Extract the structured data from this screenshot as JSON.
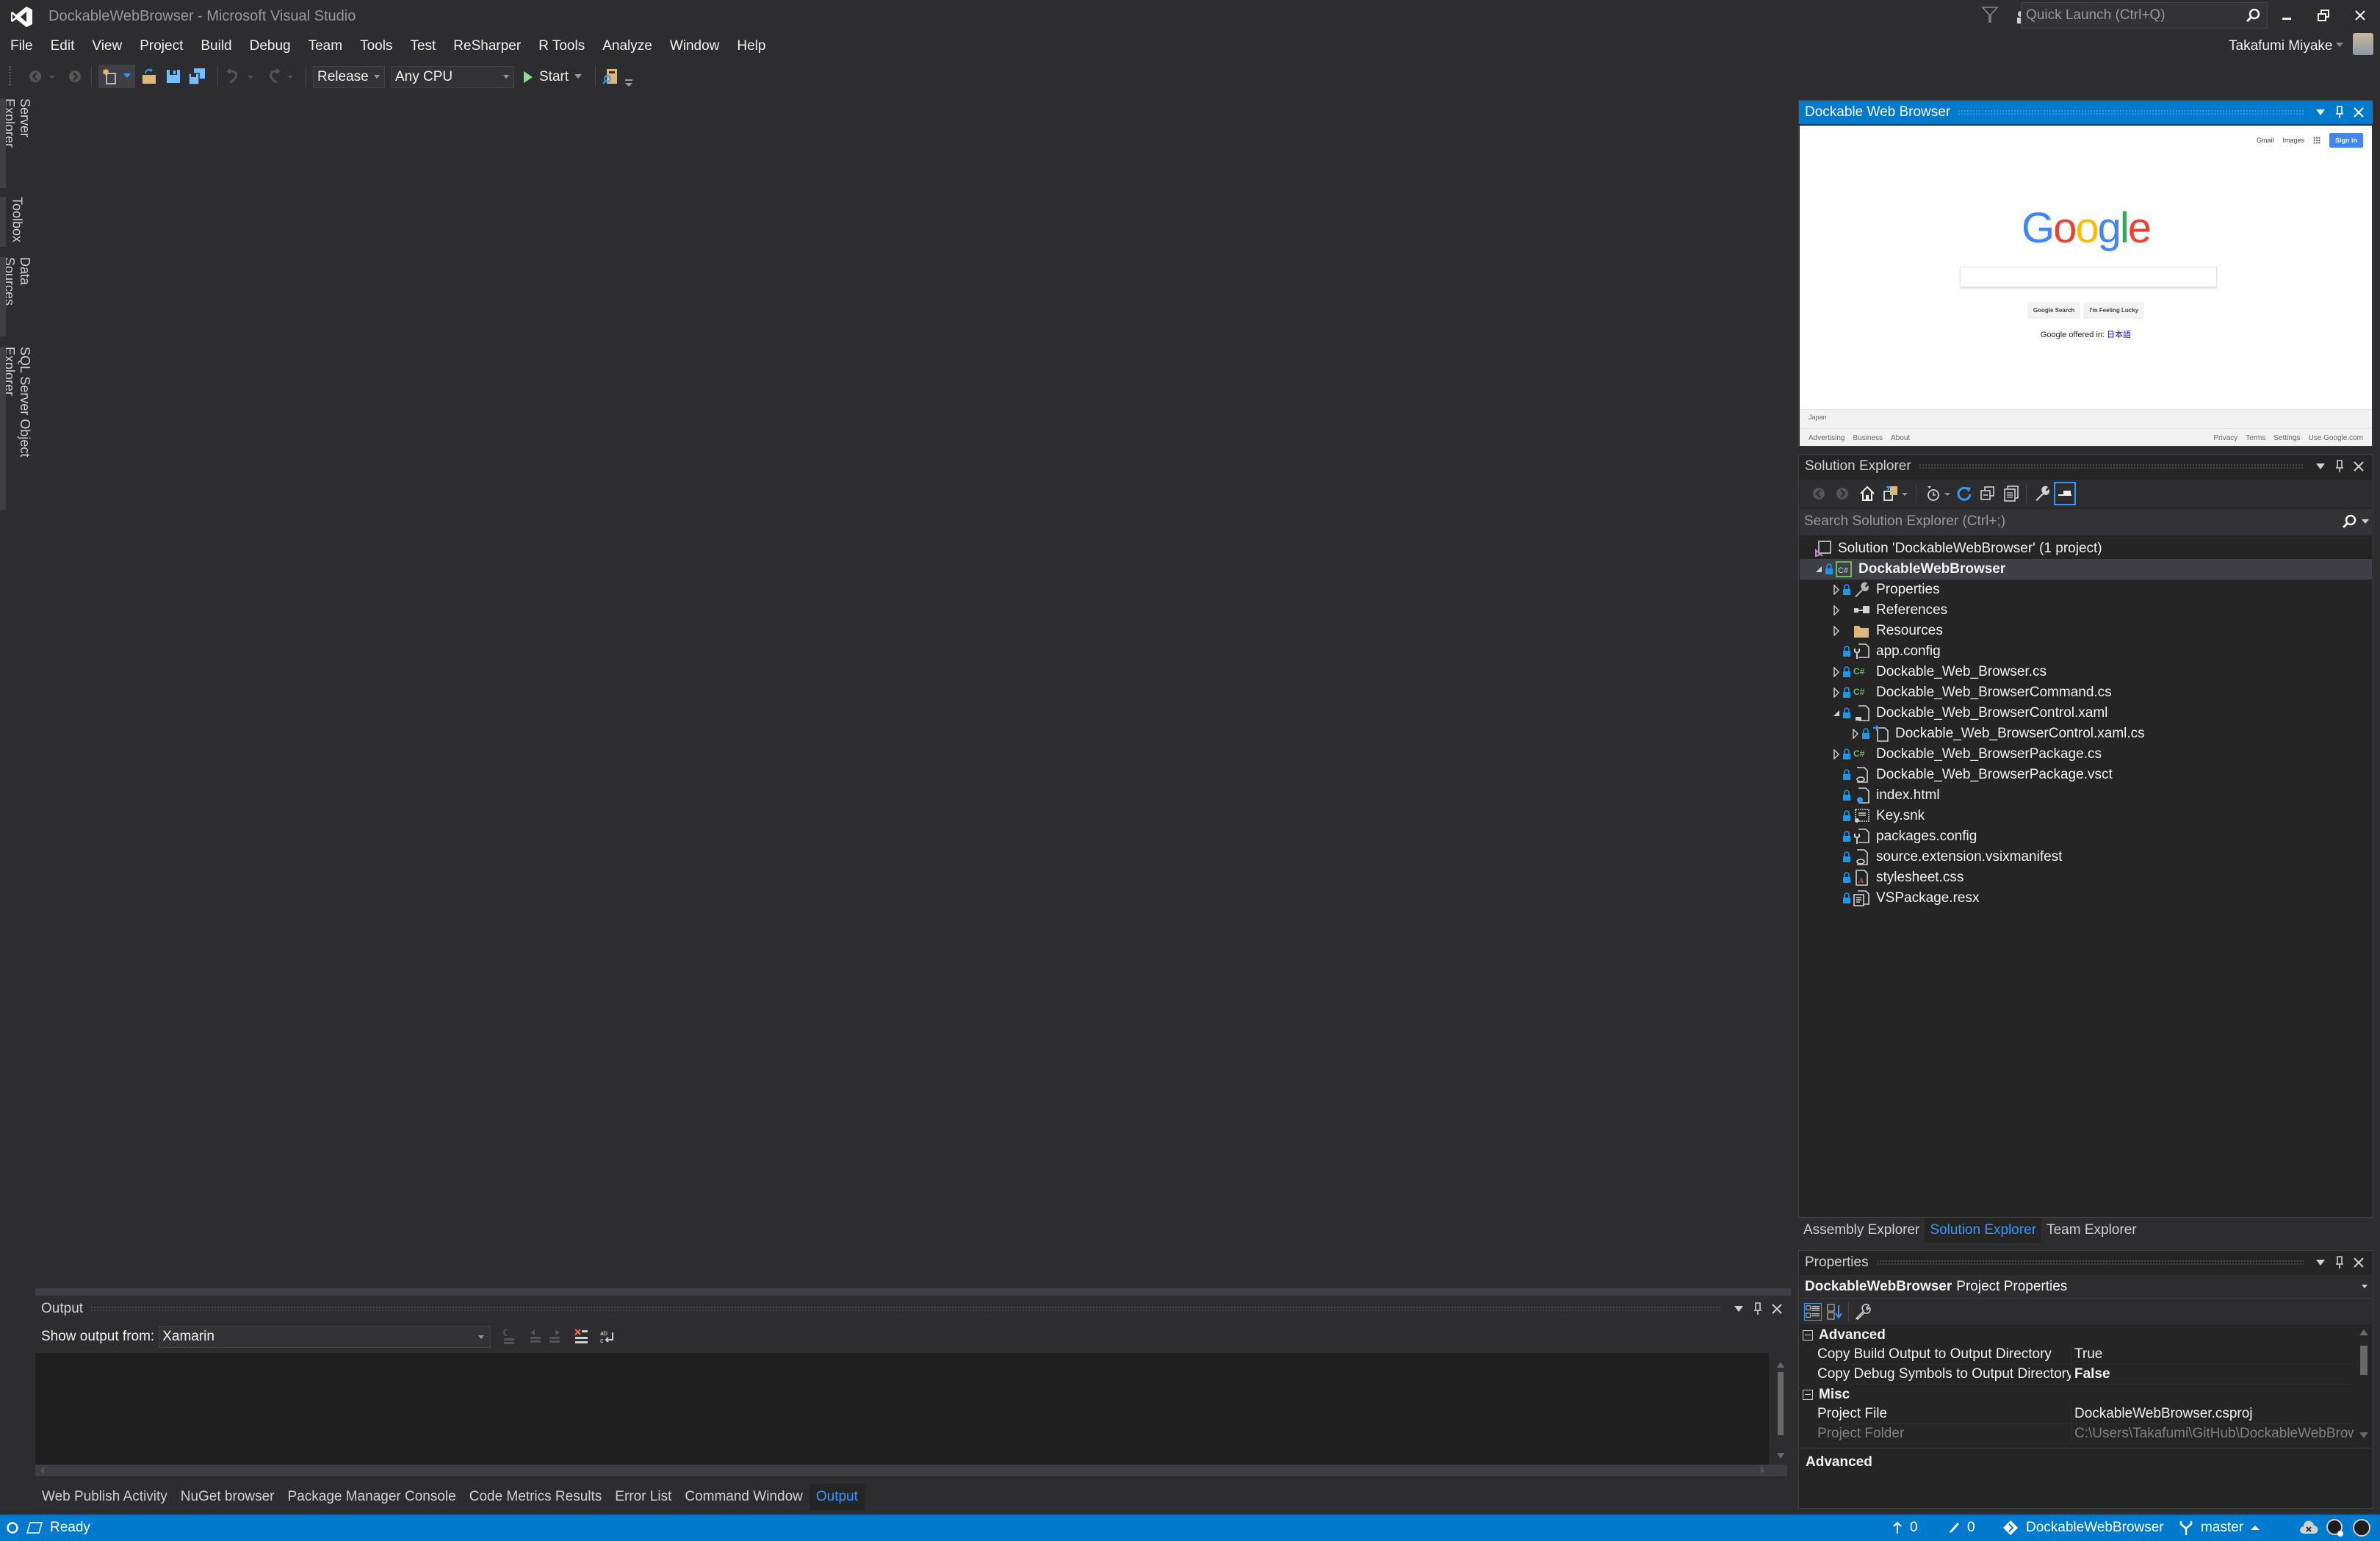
{
  "window": {
    "title": "DockableWebBrowser - Microsoft Visual Studio",
    "quick_launch_placeholder": "Quick Launch (Ctrl+Q)",
    "user_name": "Takafumi Miyake"
  },
  "menu": [
    "File",
    "Edit",
    "View",
    "Project",
    "Build",
    "Debug",
    "Team",
    "Tools",
    "Test",
    "ReSharper",
    "R Tools",
    "Analyze",
    "Window",
    "Help"
  ],
  "toolbar": {
    "configuration": "Release",
    "platform": "Any CPU",
    "start_label": "Start"
  },
  "left_tabs": [
    "Server Explorer",
    "Toolbox",
    "Data Sources",
    "SQL Server Object Explorer"
  ],
  "web_browser": {
    "title": "Dockable Web Browser",
    "page": {
      "top_links": [
        "Gmail",
        "Images"
      ],
      "sign_in": "Sign in",
      "logo_letters": [
        "G",
        "o",
        "o",
        "g",
        "l",
        "e"
      ],
      "search_value": "",
      "buttons": [
        "Google Search",
        "I'm Feeling Lucky"
      ],
      "offered_in_label": "Google offered in:",
      "offered_in_language": "日本語",
      "country": "Japan",
      "footer_left": [
        "Advertising",
        "Business",
        "About"
      ],
      "footer_right": [
        "Privacy",
        "Terms",
        "Settings",
        "Use Google.com"
      ]
    }
  },
  "solution_explorer": {
    "title": "Solution Explorer",
    "search_placeholder": "Search Solution Explorer (Ctrl+;)",
    "tree": [
      {
        "label": "Solution 'DockableWebBrowser' (1 project)",
        "icon": "solution-icon",
        "level": 0,
        "expander": "none",
        "locked": false,
        "bold": false,
        "selected": false
      },
      {
        "label": "DockableWebBrowser",
        "icon": "csharp-project-icon",
        "level": 0,
        "expander": "expanded",
        "locked": true,
        "bold": true,
        "selected": true
      },
      {
        "label": "Properties",
        "icon": "wrench-icon",
        "level": 1,
        "expander": "collapsed",
        "locked": true
      },
      {
        "label": "References",
        "icon": "references-icon",
        "level": 1,
        "expander": "collapsed",
        "locked": false
      },
      {
        "label": "Resources",
        "icon": "folder-icon",
        "level": 1,
        "expander": "collapsed",
        "locked": false
      },
      {
        "label": "app.config",
        "icon": "config-file-icon",
        "level": 1,
        "expander": "none",
        "locked": true
      },
      {
        "label": "Dockable_Web_Browser.cs",
        "icon": "csharp-file-icon",
        "level": 1,
        "expander": "collapsed",
        "locked": true
      },
      {
        "label": "Dockable_Web_BrowserCommand.cs",
        "icon": "csharp-file-icon",
        "level": 1,
        "expander": "collapsed",
        "locked": true
      },
      {
        "label": "Dockable_Web_BrowserControl.xaml",
        "icon": "xaml-file-icon",
        "level": 1,
        "expander": "expanded",
        "locked": true
      },
      {
        "label": "Dockable_Web_BrowserControl.xaml.cs",
        "icon": "code-behind-icon",
        "level": 2,
        "expander": "collapsed",
        "locked": true
      },
      {
        "label": "Dockable_Web_BrowserPackage.cs",
        "icon": "csharp-file-icon",
        "level": 1,
        "expander": "collapsed",
        "locked": true
      },
      {
        "label": "Dockable_Web_BrowserPackage.vsct",
        "icon": "xml-file-icon",
        "level": 1,
        "expander": "none",
        "locked": true
      },
      {
        "label": "index.html",
        "icon": "html-file-icon",
        "level": 1,
        "expander": "none",
        "locked": true
      },
      {
        "label": "Key.snk",
        "icon": "key-file-icon",
        "level": 1,
        "expander": "none",
        "locked": true
      },
      {
        "label": "packages.config",
        "icon": "config-file-icon",
        "level": 1,
        "expander": "none",
        "locked": true
      },
      {
        "label": "source.extension.vsixmanifest",
        "icon": "xml-file-icon",
        "level": 1,
        "expander": "none",
        "locked": true
      },
      {
        "label": "stylesheet.css",
        "icon": "css-file-icon",
        "level": 1,
        "expander": "none",
        "locked": true
      },
      {
        "label": "VSPackage.resx",
        "icon": "resx-file-icon",
        "level": 1,
        "expander": "none",
        "locked": true
      }
    ]
  },
  "explorer_tabs": [
    {
      "label": "Assembly Explorer",
      "active": false
    },
    {
      "label": "Solution Explorer",
      "active": true
    },
    {
      "label": "Team Explorer",
      "active": false
    }
  ],
  "properties": {
    "title": "Properties",
    "subject_name": "DockableWebBrowser",
    "subject_type": "Project Properties",
    "categories": [
      {
        "name": "Advanced",
        "rows": [
          {
            "key": "Copy Build Output to Output Directory",
            "value": "True",
            "bold": false,
            "disabled": false
          },
          {
            "key": "Copy Debug Symbols to Output Directory",
            "value": "False",
            "bold": true,
            "disabled": false
          }
        ]
      },
      {
        "name": "Misc",
        "rows": [
          {
            "key": "Project File",
            "value": "DockableWebBrowser.csproj",
            "bold": false,
            "disabled": false
          },
          {
            "key": "Project Folder",
            "value": "C:\\Users\\Takafumi\\GitHub\\DockableWebBrowser",
            "bold": false,
            "disabled": true
          }
        ]
      }
    ],
    "description_title": "Advanced"
  },
  "output": {
    "title": "Output",
    "show_output_from_label": "Show output from:",
    "source": "Xamarin",
    "content": ""
  },
  "bottom_tabs": [
    {
      "label": "Web Publish Activity",
      "active": false
    },
    {
      "label": "NuGet browser",
      "active": false
    },
    {
      "label": "Package Manager Console",
      "active": false
    },
    {
      "label": "Code Metrics Results",
      "active": false
    },
    {
      "label": "Error List",
      "active": false
    },
    {
      "label": "Command Window",
      "active": false
    },
    {
      "label": "Output",
      "active": true
    }
  ],
  "status": {
    "text": "Ready",
    "unpushed_commits": "0",
    "pending_changes": "0",
    "repository": "DockableWebBrowser",
    "branch": "master"
  },
  "colors": {
    "accent": "#007acc",
    "background": "#2d2d30",
    "panel": "#252526",
    "active_tab_text": "#3399ff"
  }
}
